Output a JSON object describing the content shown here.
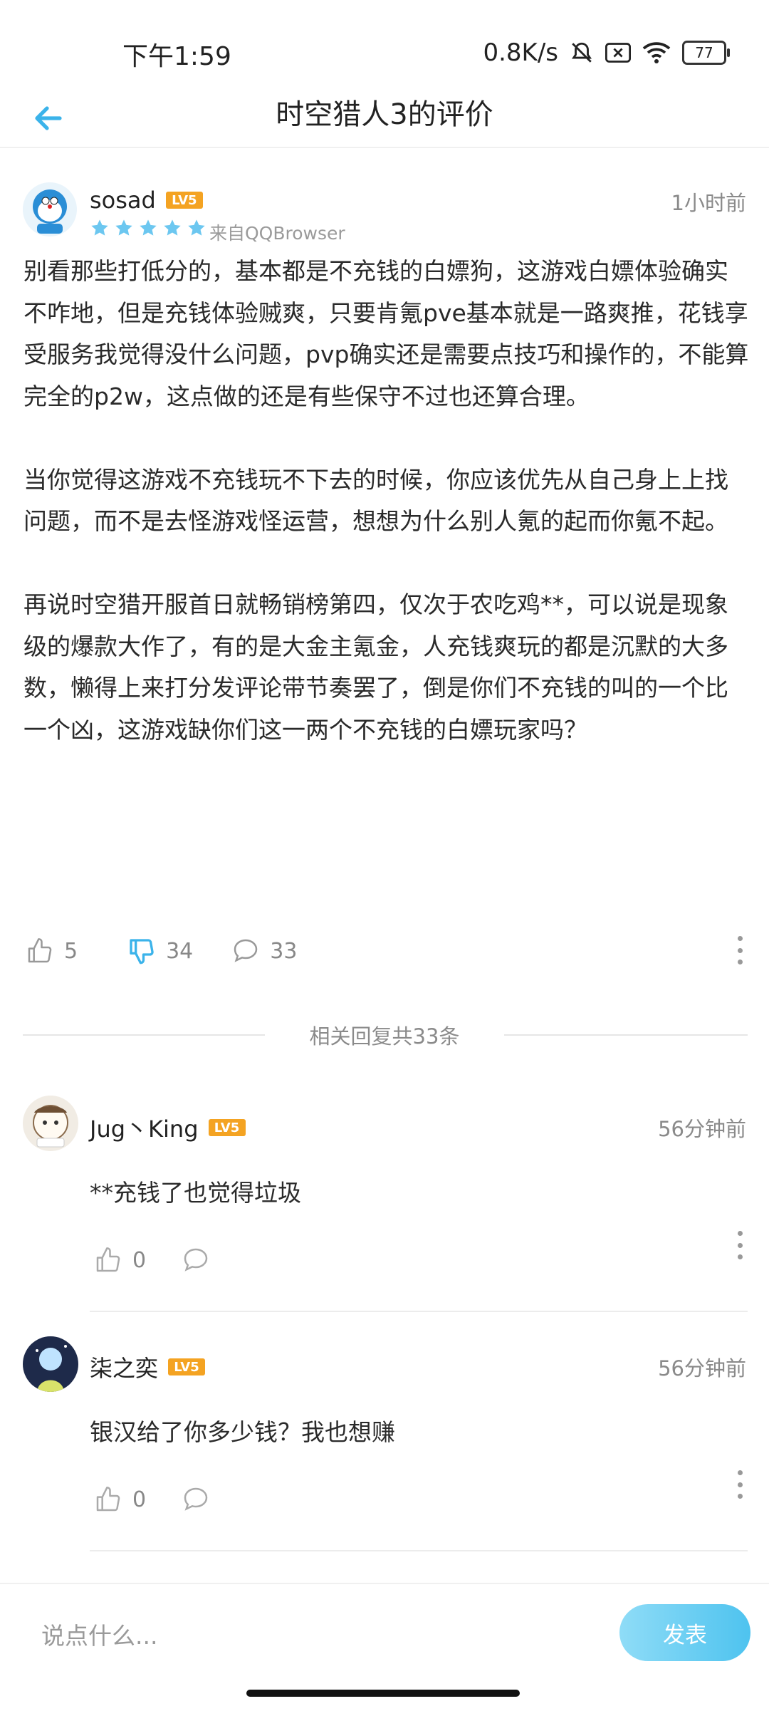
{
  "status_bar": {
    "time": "下午1:59",
    "net_speed": "0.8K/s",
    "battery": "77"
  },
  "header": {
    "title": "时空猎人3的评价",
    "back_icon": "arrow-left-icon"
  },
  "colors": {
    "accent": "#3bb3ea",
    "level_badge": "#f4a322",
    "star": "#6cc7f0"
  },
  "review": {
    "username": "sosad",
    "level": "LV5",
    "time": "1小时前",
    "rating_stars": 5,
    "source": "来自QQBrowser",
    "paragraphs": [
      "别看那些打低分的，基本都是不充钱的白嫖狗，这游戏白嫖体验确实不咋地，但是充钱体验贼爽，只要肯氪pve基本就是一路爽推，花钱享受服务我觉得没什么问题，pvp确实还是需要点技巧和操作的，不能算完全的p2w，这点做的还是有些保守不过也还算合理。",
      "当你觉得这游戏不充钱玩不下去的时候，你应该优先从自己身上上找问题，而不是去怪游戏怪运营，想想为什么别人氪的起而你氪不起。",
      "再说时空猎开服首日就畅销榜第四，仅次于农吃鸡**，可以说是现象级的爆款大作了，有的是大金主氪金，人充钱爽玩的都是沉默的大多数，懒得上来打分发评论带节奏罢了，倒是你们不充钱的叫的一个比一个凶，这游戏缺你们这一两个不充钱的白嫖玩家吗？"
    ],
    "likes": "5",
    "dislikes": "34",
    "comments": "33"
  },
  "replies_header": "相关回复共33条",
  "replies": [
    {
      "username": "Jug丶King",
      "level": "LV5",
      "time": "56分钟前",
      "text": "**充钱了也觉得垃圾",
      "likes": "0"
    },
    {
      "username": "柒之奕",
      "level": "LV5",
      "time": "56分钟前",
      "text": "银汉给了你多少钱？我也想赚",
      "likes": "0"
    }
  ],
  "input": {
    "placeholder": "说点什么...",
    "publish_label": "发表"
  }
}
